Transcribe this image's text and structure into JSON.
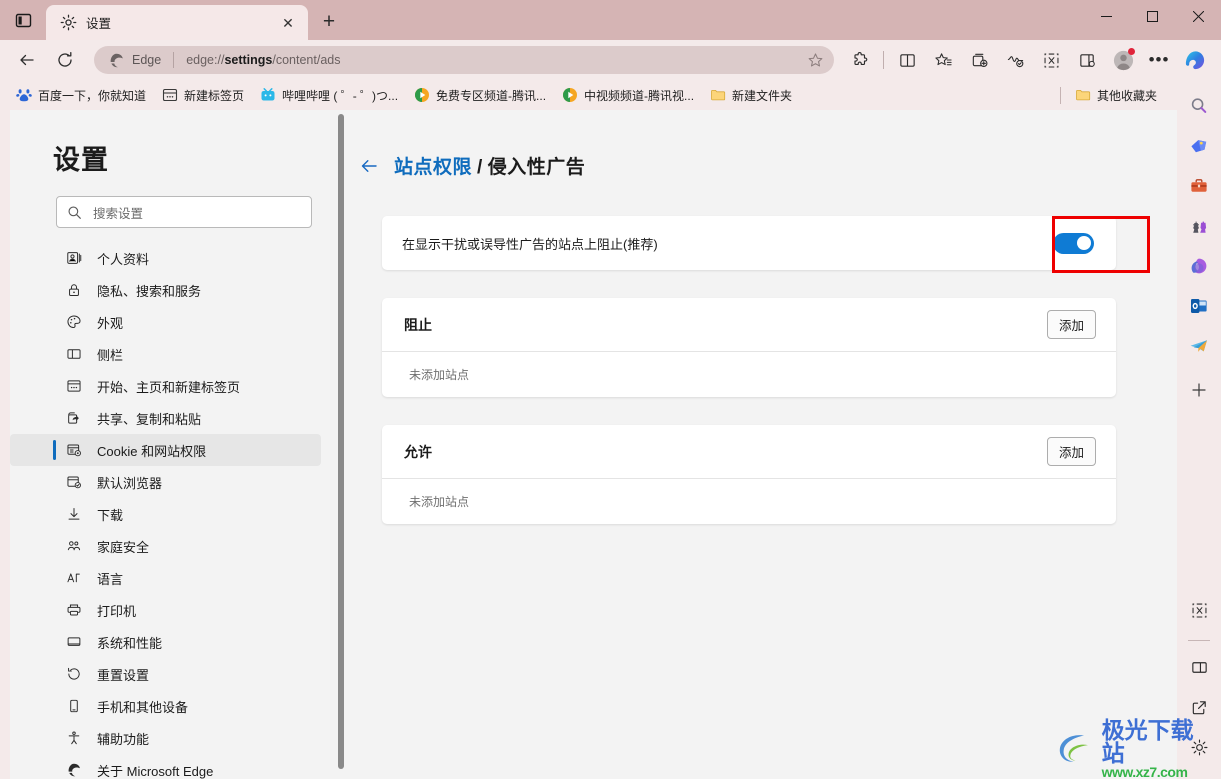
{
  "window": {
    "controls": {
      "minimize": "—",
      "maximize": "▢",
      "close": "✕"
    }
  },
  "tabstrip": {
    "tab_search_icon": "tab-actions-icon",
    "tabs": [
      {
        "title": "设置",
        "favicon": "gear-icon",
        "close_label": "✕"
      }
    ],
    "new_tab_label": "+"
  },
  "toolbar": {
    "back_label": "←",
    "refresh_label": "↻",
    "omnibox": {
      "brand_icon": "edge-logo-icon",
      "brand_label": "Edge",
      "url_prefix": "edge://",
      "url_bold": "settings",
      "url_suffix": "/content/ads",
      "full_url": "edge://settings/content/ads",
      "favorite_icon": "star-icon"
    },
    "icons": [
      {
        "name": "extensions-icon"
      },
      {
        "name": "split-screen-icon"
      },
      {
        "name": "favorites-icon"
      },
      {
        "name": "collections-icon"
      },
      {
        "name": "browser-essentials-icon"
      },
      {
        "name": "screenshot-icon"
      },
      {
        "name": "sidebar-toggle-icon"
      },
      {
        "name": "profile-avatar-icon"
      },
      {
        "name": "more-options-icon"
      },
      {
        "name": "copilot-icon"
      }
    ]
  },
  "bookmarks": {
    "items": [
      {
        "label": "百度一下，你就知道",
        "icon": "baidu-favicon"
      },
      {
        "label": "新建标签页",
        "icon": "newtab-favicon"
      },
      {
        "label": "哔哩哔哩 ( ゜- ゜)つ...",
        "icon": "bilibili-favicon"
      },
      {
        "label": "免费专区频道-腾讯...",
        "icon": "tencent-video-favicon"
      },
      {
        "label": "中视频频道-腾讯视...",
        "icon": "tencent-video-favicon"
      },
      {
        "label": "新建文件夹",
        "icon": "folder-icon"
      }
    ],
    "other_favorites": {
      "label": "其他收藏夹",
      "icon": "folder-icon"
    }
  },
  "settings": {
    "title": "设置",
    "search": {
      "placeholder": "搜索设置",
      "icon": "search-icon"
    },
    "nav_items": [
      {
        "label": "个人资料",
        "icon": "profile-icon",
        "selected": false
      },
      {
        "label": "隐私、搜索和服务",
        "icon": "lock-icon",
        "selected": false
      },
      {
        "label": "外观",
        "icon": "palette-icon",
        "selected": false
      },
      {
        "label": "侧栏",
        "icon": "sidebar-icon",
        "selected": false
      },
      {
        "label": "开始、主页和新建标签页",
        "icon": "home-icon",
        "selected": false
      },
      {
        "label": "共享、复制和粘贴",
        "icon": "share-icon",
        "selected": false
      },
      {
        "label": "Cookie 和网站权限",
        "icon": "cookie-icon",
        "selected": true
      },
      {
        "label": "默认浏览器",
        "icon": "default-browser-icon",
        "selected": false
      },
      {
        "label": "下载",
        "icon": "download-icon",
        "selected": false
      },
      {
        "label": "家庭安全",
        "icon": "family-icon",
        "selected": false
      },
      {
        "label": "语言",
        "icon": "language-icon",
        "selected": false
      },
      {
        "label": "打印机",
        "icon": "printer-icon",
        "selected": false
      },
      {
        "label": "系统和性能",
        "icon": "system-icon",
        "selected": false
      },
      {
        "label": "重置设置",
        "icon": "reset-icon",
        "selected": false
      },
      {
        "label": "手机和其他设备",
        "icon": "phone-icon",
        "selected": false
      },
      {
        "label": "辅助功能",
        "icon": "accessibility-icon",
        "selected": false
      },
      {
        "label": "关于 Microsoft Edge",
        "icon": "edge-logo-icon",
        "selected": false
      }
    ]
  },
  "content": {
    "breadcrumb": {
      "back_icon": "back-arrow-icon",
      "parent": "站点权限",
      "separator": "/",
      "current": "侵入性广告"
    },
    "toggle_row": {
      "label": "在显示干扰或误导性广告的站点上阻止(推荐)",
      "state": "on",
      "accent_color": "#0f7bd4",
      "highlight_color": "#ee0000"
    },
    "sections": [
      {
        "title": "阻止",
        "add_label": "添加",
        "empty_text": "未添加站点"
      },
      {
        "title": "允许",
        "add_label": "添加",
        "empty_text": "未添加站点"
      }
    ]
  },
  "rail": {
    "icons": [
      {
        "name": "search-icon"
      },
      {
        "name": "shopping-tag-icon"
      },
      {
        "name": "tools-icon"
      },
      {
        "name": "games-icon"
      },
      {
        "name": "office-icon"
      },
      {
        "name": "outlook-icon"
      },
      {
        "name": "telegram-icon"
      },
      {
        "name": "add-icon",
        "label": "+"
      }
    ],
    "bottom_icons": [
      {
        "name": "screenshot-icon"
      },
      {
        "name": "split-pane-icon"
      },
      {
        "name": "open-external-icon"
      },
      {
        "name": "settings-gear-icon"
      }
    ]
  },
  "watermark": {
    "main": "极光下载站",
    "sub": "www.xz7.com",
    "logo": "aurora-logo-icon"
  }
}
